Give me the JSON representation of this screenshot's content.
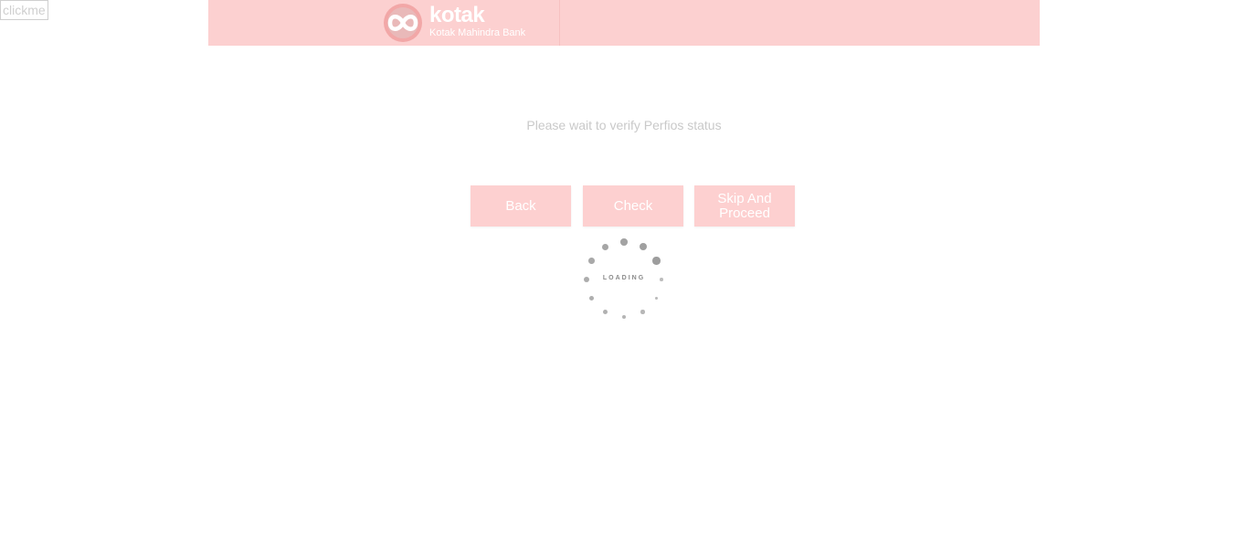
{
  "debug": {
    "clickme_label": "clickme"
  },
  "header": {
    "brand_name": "kotak",
    "brand_subtitle": "Kotak Mahindra Bank",
    "logo_icon": "infinity-logo-icon",
    "background_color": "#fcd0d0"
  },
  "main": {
    "status_text": "Please wait to verify Perfios status",
    "buttons": {
      "back": "Back",
      "check": "Check",
      "skip": "Skip And Proceed"
    },
    "loader": {
      "label": "LOADING",
      "icon": "spinner-icon"
    }
  },
  "colors": {
    "button_bg": "#fdd0d0",
    "status_text": "#c9c9c9",
    "loader_dots": "#9a9a9a"
  }
}
